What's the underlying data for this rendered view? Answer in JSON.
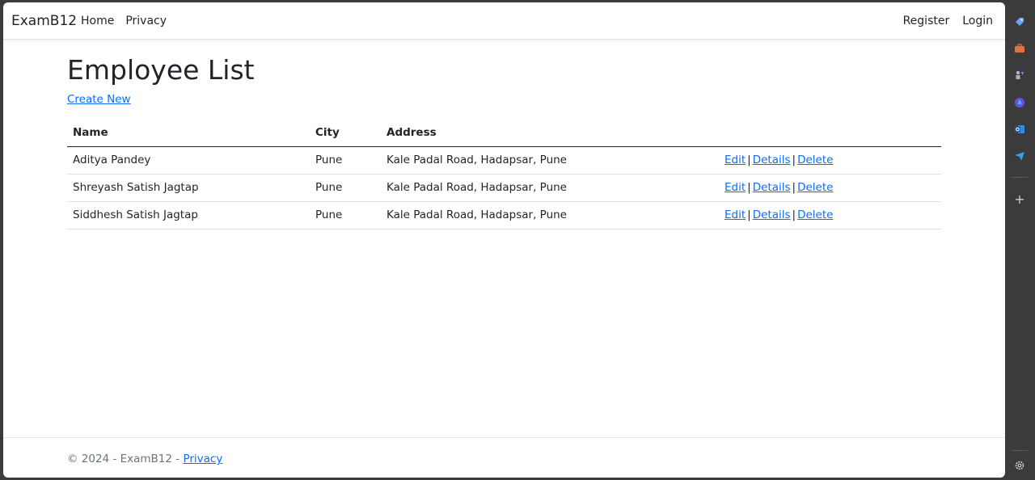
{
  "navbar": {
    "brand": "ExamB12",
    "left_links": [
      "Home",
      "Privacy"
    ],
    "right_links": [
      "Register",
      "Login"
    ]
  },
  "main": {
    "title": "Employee List",
    "create_link": "Create New",
    "table": {
      "headers": [
        "Name",
        "City",
        "Address"
      ],
      "rows": [
        {
          "name": "Aditya Pandey",
          "city": "Pune",
          "address": "Kale Padal Road, Hadapsar, Pune"
        },
        {
          "name": "Shreyash Satish Jagtap",
          "city": "Pune",
          "address": "Kale Padal Road, Hadapsar, Pune"
        },
        {
          "name": "Siddhesh Satish Jagtap",
          "city": "Pune",
          "address": "Kale Padal Road, Hadapsar, Pune"
        }
      ],
      "actions": {
        "edit": "Edit",
        "details": "Details",
        "delete": "Delete",
        "separator": "|"
      }
    }
  },
  "footer": {
    "copyright": "© 2024 - ExamB12 - ",
    "privacy_link": "Privacy"
  },
  "sidebar": {
    "icons": [
      "tag-icon",
      "briefcase-icon",
      "chess-icon",
      "copilot-icon",
      "outlook-icon",
      "send-icon",
      "add-icon",
      "settings-icon"
    ]
  },
  "colors": {
    "link": "#0d6efd",
    "text": "#212529",
    "muted": "#6c757d",
    "sidebar_bg": "#3b3b3b"
  }
}
